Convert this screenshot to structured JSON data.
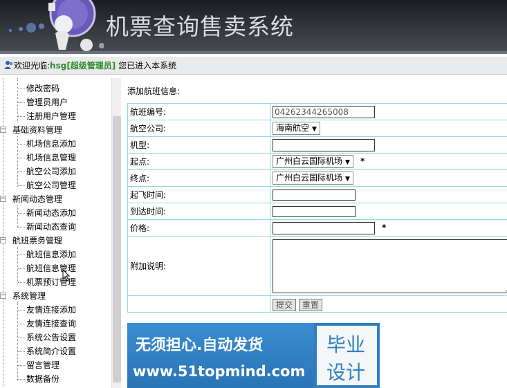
{
  "header": {
    "title": "机票查询售卖系统"
  },
  "infobar": {
    "prefix": "欢迎光临:",
    "username": "hsg[超级管理员]",
    "suffix": " 您已进入本系统"
  },
  "sidebar": {
    "top_children": [
      "修改密码",
      "管理员用户",
      "注册用户管理"
    ],
    "groups": [
      {
        "label": "基础资料管理",
        "toggle": "−",
        "children": [
          "机场信息添加",
          "机场信息管理",
          "航空公司添加",
          "航空公司管理"
        ]
      },
      {
        "label": "新闻动态管理",
        "toggle": "−",
        "children": [
          "新闻动态添加",
          "新闻动态查询"
        ]
      },
      {
        "label": "航班票务管理",
        "toggle": "−",
        "children": [
          "航班信息添加",
          "航班信息管理",
          "机票预订管理"
        ]
      },
      {
        "label": "系统管理",
        "toggle": "−",
        "children": [
          "友情连接添加",
          "友情连接查询",
          "系统公告设置",
          "系统简介设置",
          "留言管理",
          "数据备份"
        ]
      }
    ]
  },
  "content": {
    "heading": "添加航班信息:",
    "form": {
      "flight_no_label": "航班编号:",
      "flight_no_value": "04262344265008",
      "airline_label": "航空公司:",
      "airline_value": "海南航空",
      "model_label": "机型:",
      "model_value": "",
      "origin_label": "起点:",
      "origin_value": "广州白云国际机场",
      "dest_label": "终点:",
      "dest_value": "广州白云国际机场",
      "depart_label": "起飞时间:",
      "depart_value": "",
      "arrive_label": "到达时间:",
      "arrive_value": "",
      "price_label": "价格:",
      "price_value": "",
      "notes_label": "附加说明:",
      "required_mark": "*",
      "submit_label": "提交",
      "reset_label": "重置"
    }
  },
  "ad": {
    "line1": "无须担心.自动发货",
    "line2": "www.51topmind.com",
    "side1": "毕业",
    "side2": "设计"
  },
  "icons": {
    "toggle": "minus-box-icon",
    "user": "user-icon",
    "select": "chevron-down-icon"
  }
}
